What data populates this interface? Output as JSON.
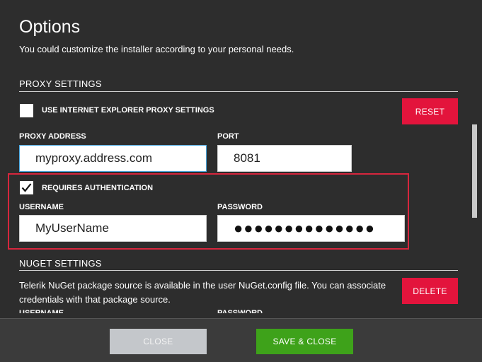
{
  "header": {
    "title": "Options",
    "subtitle": "You could customize the installer according to your personal needs."
  },
  "proxy": {
    "section_title": "PROXY SETTINGS",
    "use_ie_label": "USE INTERNET EXPLORER PROXY SETTINGS",
    "use_ie_checked": false,
    "reset_label": "RESET",
    "address_label": "PROXY ADDRESS",
    "address_value": "myproxy.address.com",
    "port_label": "PORT",
    "port_value": "8081",
    "auth_label": "REQUIRES AUTHENTICATION",
    "auth_checked": true,
    "username_label": "USERNAME",
    "username_value": "MyUserName",
    "password_label": "PASSWORD",
    "password_value": "●●●●●●●●●●●●●●"
  },
  "nuget": {
    "section_title": "NUGET SETTINGS",
    "description": "Telerik NuGet package source is available in the user NuGet.config file. You can associate credentials with that package source.",
    "delete_label": "DELETE",
    "username_label": "USERNAME",
    "password_label": "PASSWORD"
  },
  "footer": {
    "close_label": "CLOSE",
    "save_close_label": "SAVE & CLOSE"
  },
  "colors": {
    "background": "#2d2d2d",
    "accent_red": "#e3143c",
    "save_green": "#3ea21a",
    "disabled_gray": "#c4c7cb",
    "highlight_box": "#d7263d"
  }
}
